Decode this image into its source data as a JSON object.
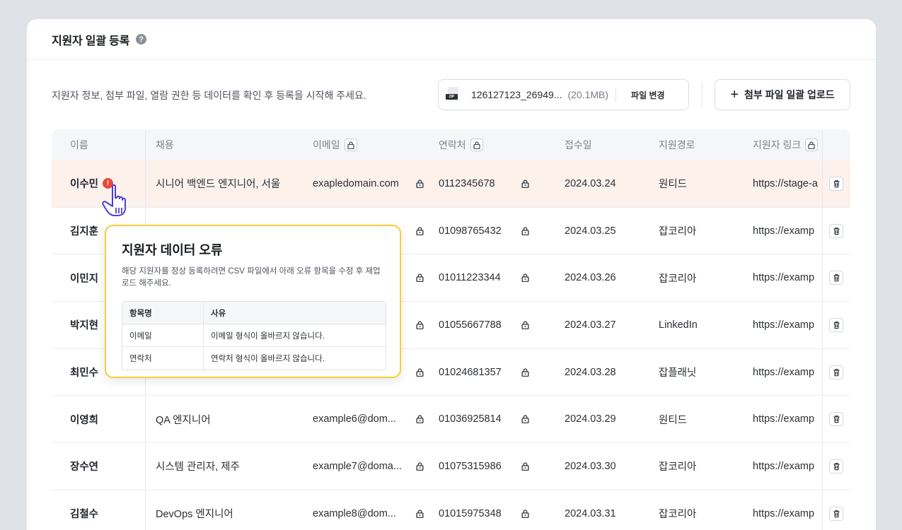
{
  "header": {
    "title": "지원자 일괄 등록"
  },
  "toolbar": {
    "description": "지원자 정보, 첨부 파일, 열람 권한 등 데이터를 확인 후 등록을 시작해 주세요.",
    "file_name": "126127123_26949...",
    "file_size": "(20.1MB)",
    "file_type": "ZIP",
    "change_label": "파일 변경",
    "upload_label": "첨부 파일 일괄 업로드"
  },
  "table": {
    "columns": {
      "name": "이름",
      "job": "채용",
      "email": "이메일",
      "phone": "연락처",
      "date": "접수일",
      "source": "지원경로",
      "link": "지원자 링크"
    },
    "rows": [
      {
        "name": "이수민",
        "job": "시니어 백엔드 엔지니어, 서울",
        "email": "exapledomain.com",
        "phone": "0112345678",
        "date": "2024.03.24",
        "source": "원티드",
        "link": "https://stage-a",
        "error": true
      },
      {
        "name": "김지훈",
        "job": "",
        "email": "",
        "phone": "01098765432",
        "date": "2024.03.25",
        "source": "잡코리아",
        "link": "https://examp"
      },
      {
        "name": "이민지",
        "job": "",
        "email": "",
        "phone": "01011223344",
        "date": "2024.03.26",
        "source": "잡코리아",
        "link": "https://examp"
      },
      {
        "name": "박지현",
        "job": "",
        "email": "",
        "phone": "01055667788",
        "date": "2024.03.27",
        "source": "LinkedIn",
        "link": "https://examp"
      },
      {
        "name": "최민수",
        "job": "",
        "email": "",
        "phone": "01024681357",
        "date": "2024.03.28",
        "source": "잡플래닛",
        "link": "https://examp"
      },
      {
        "name": "이영희",
        "job": "QA 엔지니어",
        "email": "example6@dom...",
        "phone": "01036925814",
        "date": "2024.03.29",
        "source": "원티드",
        "link": "https://examp"
      },
      {
        "name": "장수연",
        "job": "시스템 관리자, 제주",
        "email": "example7@doma...",
        "phone": "01075315986",
        "date": "2024.03.30",
        "source": "잡코리아",
        "link": "https://examp"
      },
      {
        "name": "김철수",
        "job": "DevOps 엔지니어",
        "email": "example8@dom...",
        "phone": "01015975348",
        "date": "2024.03.31",
        "source": "잡코리아",
        "link": "https://examp"
      }
    ]
  },
  "tooltip": {
    "title": "지원자 데이터 오류",
    "description": "해당 지원자를 정상 등록하려면 CSV 파일에서 아래 오류 항목을 수정 후 재업로드 해주세요.",
    "col_field": "항목명",
    "col_reason": "사유",
    "items": [
      {
        "field": "이메일",
        "reason": "이메일 형식이 올바르지 않습니다."
      },
      {
        "field": "연락처",
        "reason": "연락처 형식이 올바르지 않습니다."
      }
    ]
  },
  "colors": {
    "error_row": "#fdf1ec",
    "error_badge": "#e8493b",
    "tooltip_border": "#f5cf3a"
  }
}
